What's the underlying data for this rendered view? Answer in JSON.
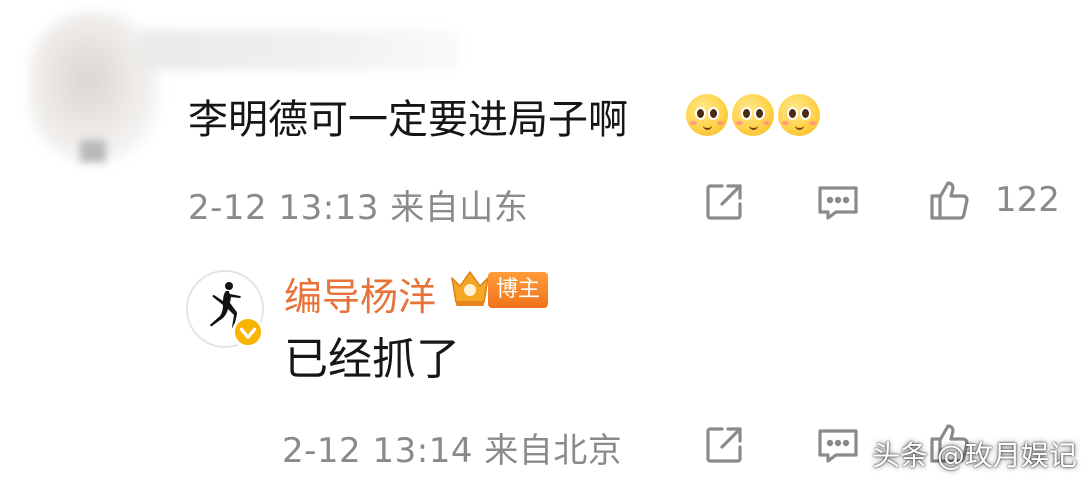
{
  "top_comment": {
    "text": "李明德可一定要进局子啊",
    "emojis": [
      "pleading-face-icon",
      "pleading-face-icon",
      "pleading-face-icon"
    ],
    "time": "2-12 13:13",
    "location": "来自山东",
    "like_count": "122"
  },
  "reply": {
    "author": "编导杨洋",
    "badge": "博主",
    "text": "已经抓了",
    "time": "2-12 13:14",
    "location": "来自北京"
  },
  "watermark": "头条 @玫月娱记",
  "colors": {
    "author_name": "#e8733a",
    "meta_gray": "#8a8a8a",
    "badge_orange": "#f0731b",
    "verified_yellow": "#f7b500"
  }
}
